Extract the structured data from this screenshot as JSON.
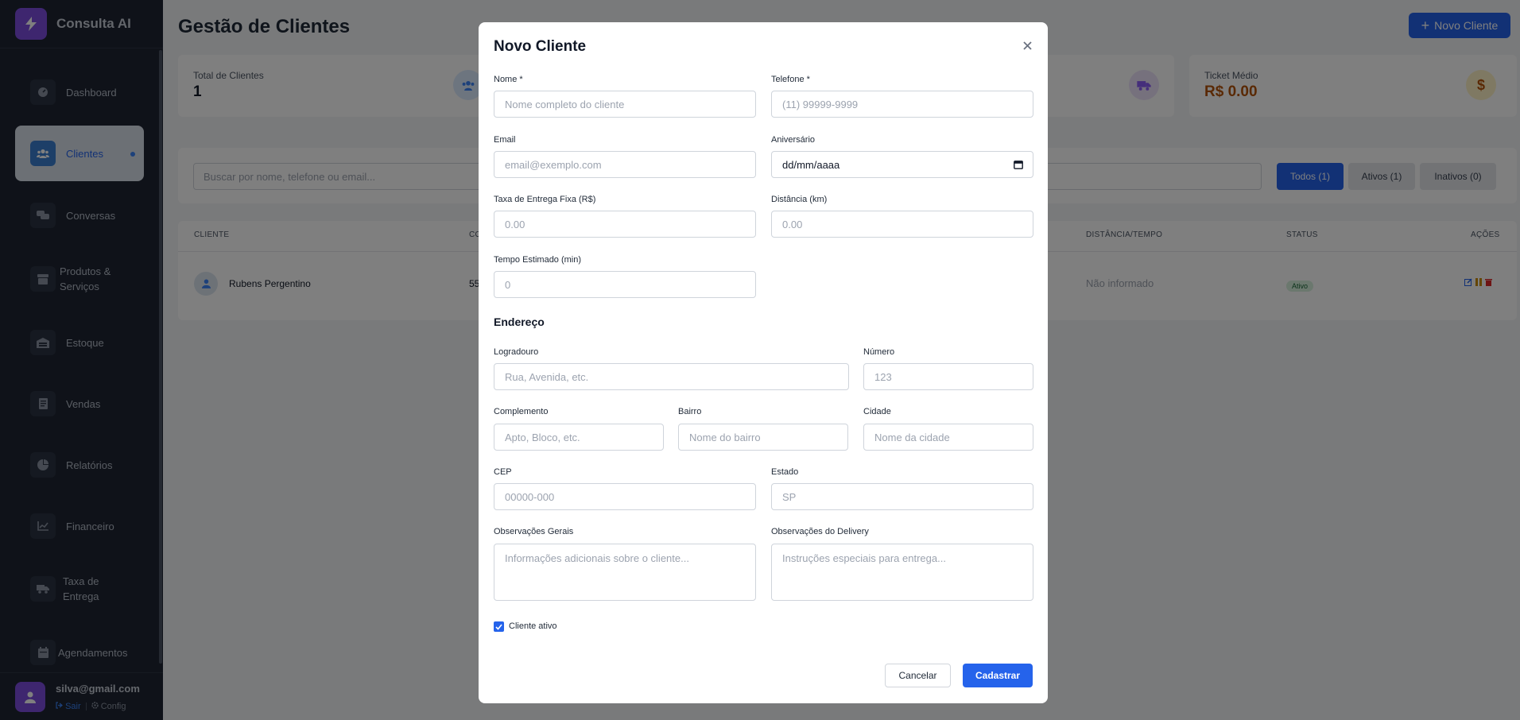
{
  "app": {
    "name": "Consulta AI"
  },
  "sidebar": {
    "items": [
      {
        "label": "Dashboard",
        "icon": "dashboard-icon"
      },
      {
        "label": "Clientes",
        "icon": "users-icon",
        "active": true
      },
      {
        "label": "Conversas",
        "icon": "chat-icon"
      },
      {
        "label": "Produtos & Serviços",
        "icon": "box-icon"
      },
      {
        "label": "Estoque",
        "icon": "warehouse-icon"
      },
      {
        "label": "Vendas",
        "icon": "receipt-icon"
      },
      {
        "label": "Relatórios",
        "icon": "pie-chart-icon"
      },
      {
        "label": "Financeiro",
        "icon": "line-chart-icon"
      },
      {
        "label": "Taxa de Entrega",
        "icon": "truck-icon"
      },
      {
        "label": "Agendamentos",
        "icon": "calendar-icon"
      }
    ],
    "user": {
      "email": "silva@gmail.com",
      "logout": "Sair",
      "config": "Config"
    }
  },
  "main": {
    "title": "Gestão de Clientes",
    "new_button": "Novo Cliente",
    "stats": [
      {
        "label": "Total de Clientes",
        "value": "1",
        "icon": "users-icon"
      },
      {
        "label": "",
        "value": "",
        "icon": "truck-icon"
      },
      {
        "label": "Ticket Médio",
        "value": "R$ 0.00",
        "icon": "dollar-icon"
      }
    ],
    "search_placeholder": "Buscar por nome, telefone ou email...",
    "filters": {
      "all": "Todos (1)",
      "active": "Ativos (1)",
      "inactive": "Inativos (0)"
    },
    "table": {
      "headers": {
        "cliente": "CLIENTE",
        "contato": "CO",
        "distancia": "DISTÂNCIA/TEMPO",
        "status": "STATUS",
        "acoes": "AÇÕES"
      },
      "rows": [
        {
          "name": "Rubens Pergentino",
          "phone": "55",
          "distance": "Não informado",
          "status": "Ativo"
        }
      ]
    }
  },
  "modal": {
    "title": "Novo Cliente",
    "fields": {
      "nome": {
        "label": "Nome *",
        "placeholder": "Nome completo do cliente"
      },
      "telefone": {
        "label": "Telefone *",
        "placeholder": "(11) 99999-9999"
      },
      "email": {
        "label": "Email",
        "placeholder": "email@exemplo.com"
      },
      "aniversario": {
        "label": "Aniversário",
        "value": "dd/mm/aaaa"
      },
      "taxa": {
        "label": "Taxa de Entrega Fixa (R$)",
        "placeholder": "0.00"
      },
      "distancia": {
        "label": "Distância (km)",
        "placeholder": "0.00"
      },
      "tempo": {
        "label": "Tempo Estimado (min)",
        "placeholder": "0"
      }
    },
    "address_title": "Endereço",
    "address": {
      "logradouro": {
        "label": "Logradouro",
        "placeholder": "Rua, Avenida, etc."
      },
      "numero": {
        "label": "Número",
        "placeholder": "123"
      },
      "complemento": {
        "label": "Complemento",
        "placeholder": "Apto, Bloco, etc."
      },
      "bairro": {
        "label": "Bairro",
        "placeholder": "Nome do bairro"
      },
      "cidade": {
        "label": "Cidade",
        "placeholder": "Nome da cidade"
      },
      "cep": {
        "label": "CEP",
        "placeholder": "00000-000"
      },
      "estado": {
        "label": "Estado",
        "placeholder": "SP"
      }
    },
    "notes": {
      "geral": {
        "label": "Observações Gerais",
        "placeholder": "Informações adicionais sobre o cliente..."
      },
      "delivery": {
        "label": "Observações do Delivery",
        "placeholder": "Instruções especiais para entrega..."
      }
    },
    "active_checkbox": {
      "label": "Cliente ativo",
      "checked": true
    },
    "cancel": "Cancelar",
    "submit": "Cadastrar"
  },
  "colors": {
    "primary": "#2563eb",
    "sidebar": "#1e2533",
    "brand": "#7c4dde",
    "ticket": "#b45309"
  }
}
